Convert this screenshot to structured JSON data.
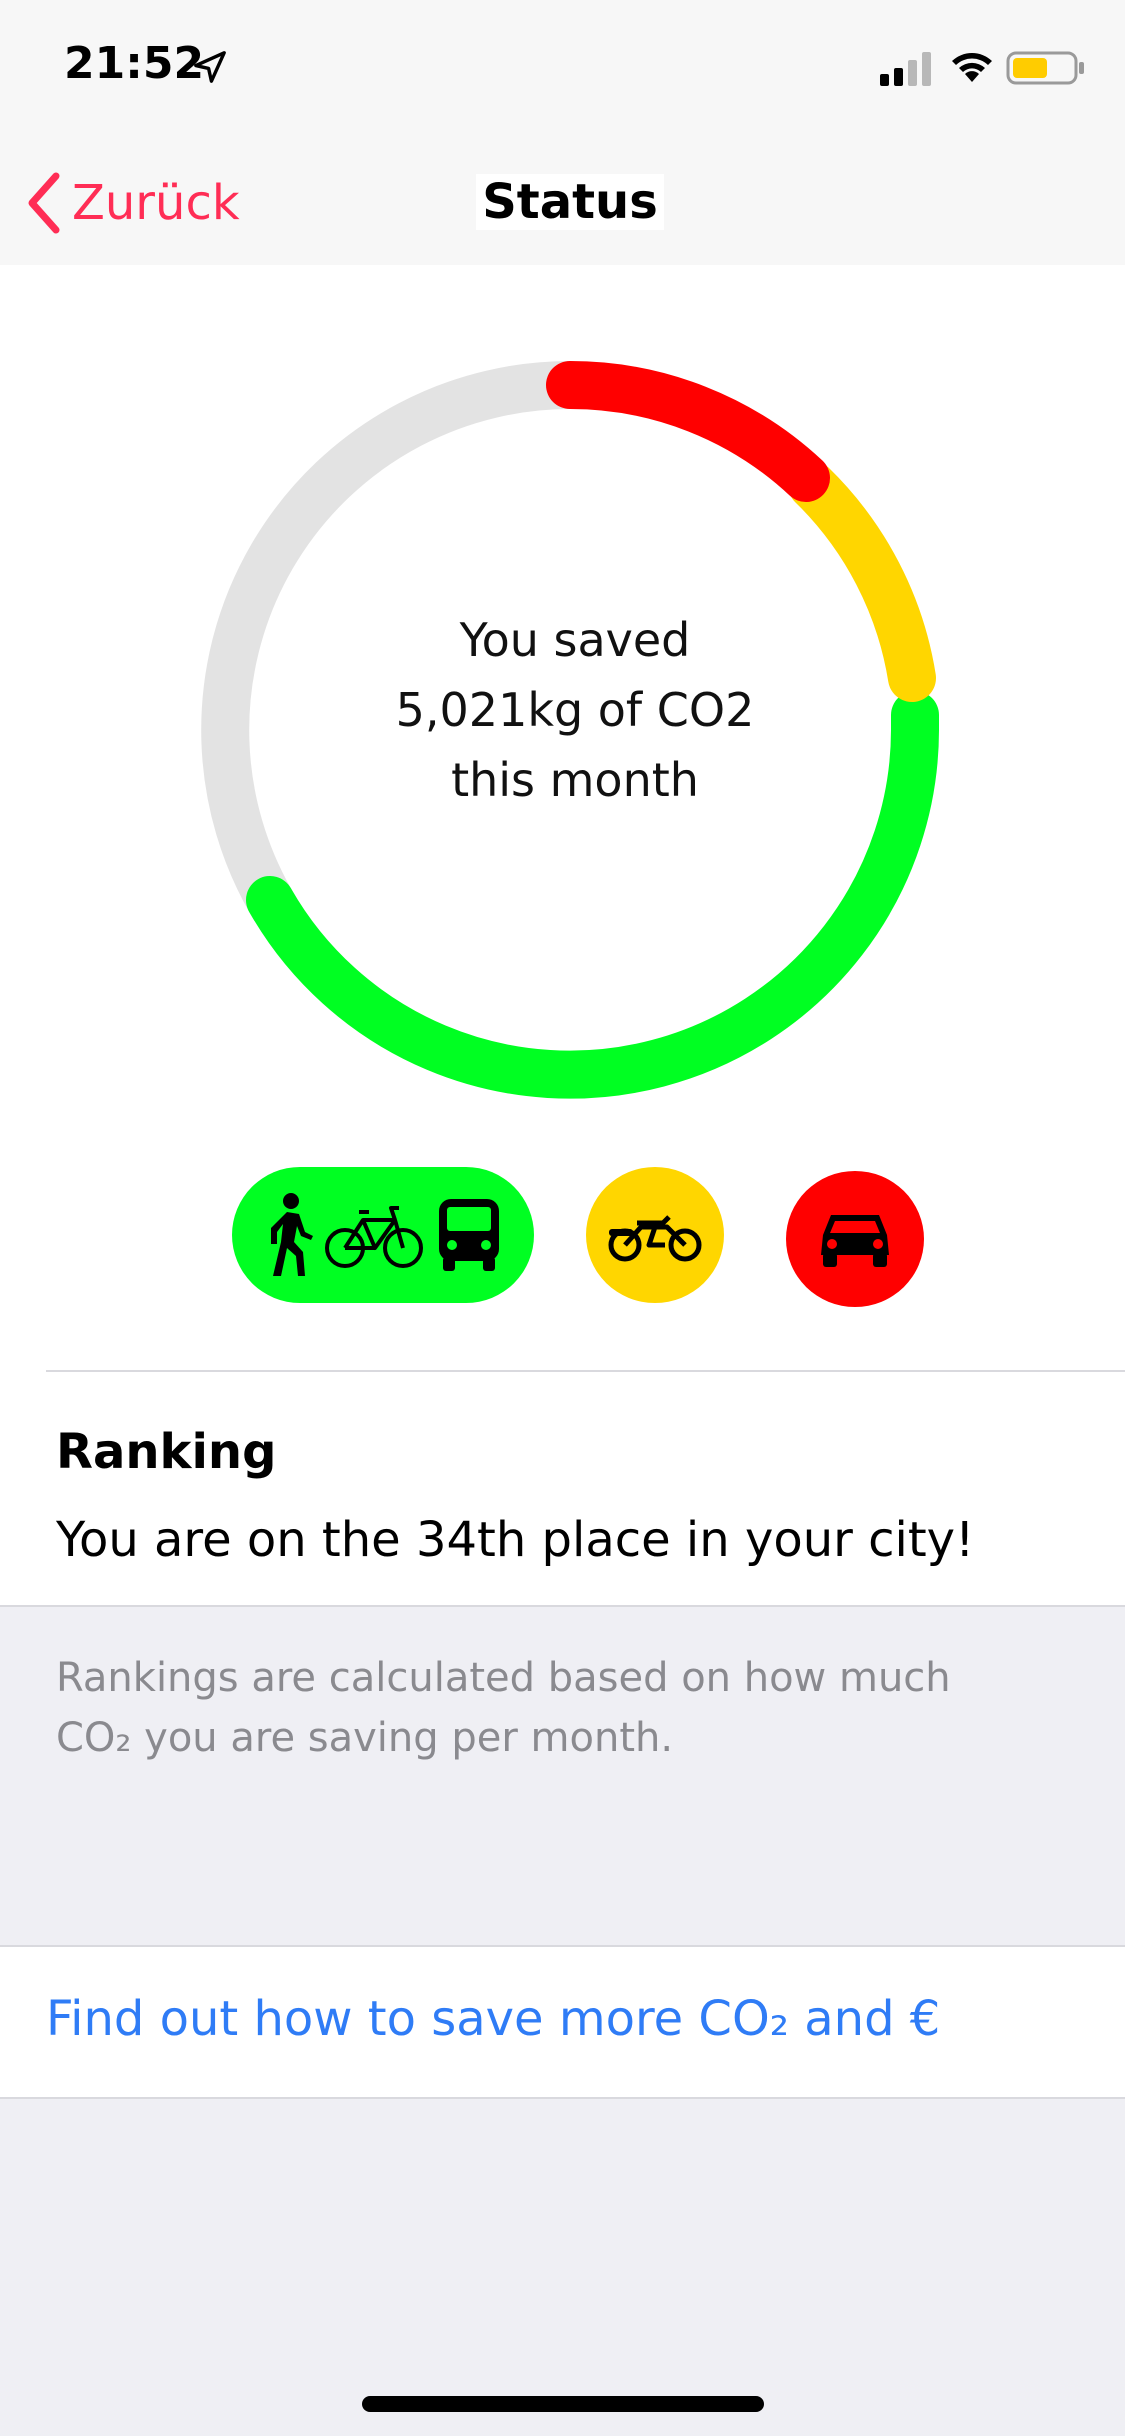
{
  "status_bar": {
    "time": "21:52",
    "icons": [
      "location-arrow-icon",
      "cellular-signal-icon",
      "wifi-icon",
      "battery-icon"
    ]
  },
  "nav": {
    "back_label": "Zurück",
    "title": "Status"
  },
  "summary": {
    "line1": "You saved",
    "line2": "5,021kg of CO2",
    "line3": "this month",
    "ring_segments": [
      {
        "name": "green",
        "color": "#00ff22"
      },
      {
        "name": "yellow",
        "color": "#ffd600"
      },
      {
        "name": "red",
        "color": "#ff0000"
      },
      {
        "name": "remaining",
        "color": "#e3e3e3"
      }
    ]
  },
  "transport_categories": [
    {
      "color": "#00ff22",
      "icons": [
        "walking-icon",
        "bicycle-icon",
        "bus-icon"
      ]
    },
    {
      "color": "#ffd600",
      "icons": [
        "motorcycle-icon"
      ]
    },
    {
      "color": "#ff0000",
      "icons": [
        "car-icon"
      ]
    }
  ],
  "ranking": {
    "title": "Ranking",
    "text": "You are on the 34th place in your city!",
    "footnote_line1": "Rankings are calculated based on how much",
    "footnote_line2": "CO₂ you are saving per month."
  },
  "link": {
    "label": "Find out how to save more CO₂ and €"
  },
  "colors": {
    "accent_back": "#ff2d55",
    "link": "#2f7cf6"
  }
}
